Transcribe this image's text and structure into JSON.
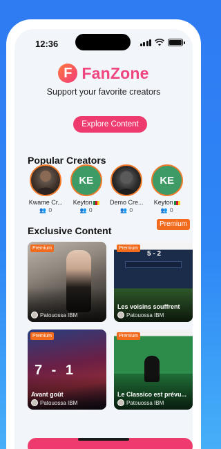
{
  "status_bar": {
    "time": "12:36"
  },
  "brand": {
    "logo_letter": "F",
    "name": "FanZone",
    "tagline": "Support your favorite creators"
  },
  "hero": {
    "explore_label": "Explore Content"
  },
  "popular": {
    "title": "Popular Creators",
    "creators": [
      {
        "name": "Kwame Cr...",
        "count": "0",
        "avatar": "photo"
      },
      {
        "name": "Keyton",
        "count": "0",
        "initials": "KE",
        "flag": true
      },
      {
        "name": "Demo Cre...",
        "count": "0",
        "avatar": "photo"
      },
      {
        "name": "Keyton",
        "count": "0",
        "initials": "KE",
        "flag": true
      }
    ]
  },
  "exclusive": {
    "title": "Exclusive Content",
    "premium_label": "Premium",
    "cards": [
      {
        "badge": "Premium",
        "caption": "",
        "author": "Patouossa IBM"
      },
      {
        "badge": "Premium",
        "caption": "Les voisins souffrent",
        "author": "Patouossa IBM",
        "score": "5 - 2"
      },
      {
        "badge": "Premium",
        "caption": "Avant goût",
        "author": "Patouossa IBM",
        "score": "7 - 1"
      },
      {
        "badge": "Premium",
        "caption": "Le Classico est prévu...",
        "author": "Patouossa IBM"
      }
    ]
  },
  "colors": {
    "accent": "#EE3B6D",
    "premium": "#F26B1D",
    "initials_bg": "#3E9B66",
    "avatar_ring": "#F07A2A"
  }
}
